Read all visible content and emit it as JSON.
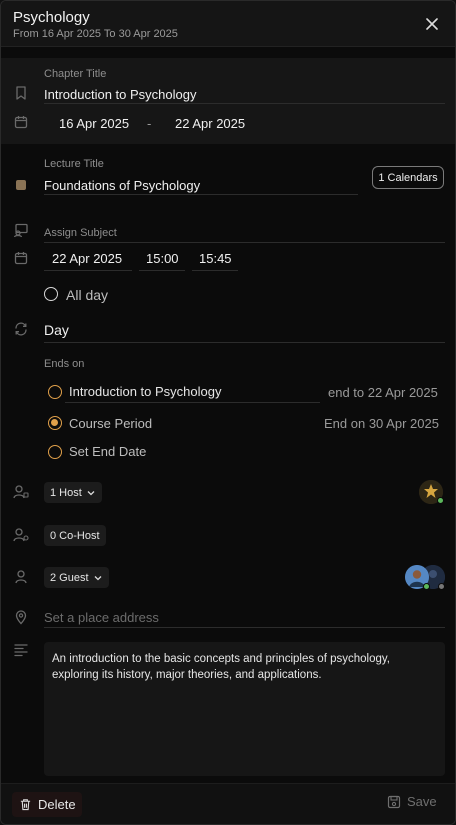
{
  "header": {
    "title": "Psychology",
    "subtitle": "From 16 Apr 2025 To 30 Apr 2025"
  },
  "chapter": {
    "label": "Chapter Title",
    "value": "Introduction to Psychology",
    "start_date": "16 Apr 2025",
    "separator": "-",
    "end_date": "22 Apr 2025"
  },
  "lecture": {
    "label": "Lecture Title",
    "value": "Foundations of Psychology",
    "calendars_button": "1 Calendars",
    "color": "#8a7355"
  },
  "subject": {
    "label": "Assign Subject",
    "date": "22 Apr 2025",
    "start_time": "15:00",
    "end_time": "15:45",
    "all_day_label": "All day"
  },
  "repeat": {
    "value": "Day",
    "ends_on_label": "Ends on",
    "options": [
      {
        "label": "Introduction to Psychology",
        "right": "end to 22 Apr 2025",
        "selected": false
      },
      {
        "label": "Course Period",
        "right": "End on 30 Apr 2025",
        "selected": true
      },
      {
        "label": "Set End Date",
        "right": "",
        "selected": false
      }
    ]
  },
  "people": {
    "host": "1 Host",
    "cohost": "0 Co-Host",
    "guest": "2 Guest"
  },
  "place": {
    "placeholder": "Set a place address"
  },
  "description": {
    "text": "An introduction to the basic concepts and principles of psychology, exploring its history, major theories, and applications."
  },
  "footer": {
    "delete_label": "Delete",
    "save_label": "Save"
  },
  "colors": {
    "accent_orange": "#e0a04a",
    "status_green": "#5cb85c"
  }
}
